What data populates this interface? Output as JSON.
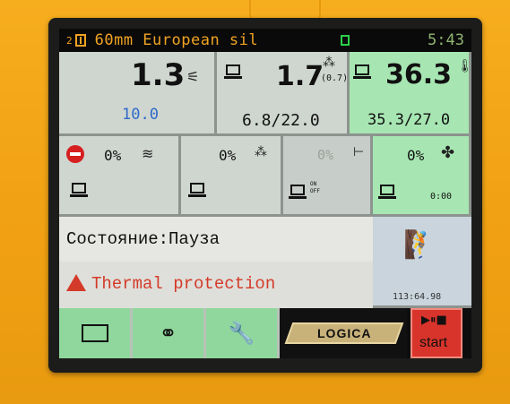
{
  "header": {
    "program_number": "2",
    "title": "60mm European sil",
    "time": "5:43"
  },
  "panels": {
    "p1": {
      "value": "1.3",
      "sub": "10.0"
    },
    "p2": {
      "value": "1.7",
      "small": "(0.7)",
      "sub": "6.8/22.0"
    },
    "p3": {
      "value": "36.3",
      "sub": "35.3/27.0"
    }
  },
  "row2": {
    "heater_pct": "0%",
    "spray_pct": "0%",
    "dim_pct": "0%",
    "fan_pct": "0%",
    "counter": "0:00",
    "on_label": "ON",
    "off_label": "OFF"
  },
  "status": {
    "state": "Состояние:Пауза",
    "alarm": "Thermal protection"
  },
  "operator": {
    "value": "113:64.98"
  },
  "footer": {
    "brand": "LOGICA",
    "start_label": "start"
  },
  "colors": {
    "accent": "#f0a322",
    "alarm": "#d43a2a",
    "panel_green": "#a7e6b2",
    "panel_gray": "#cfd6d0",
    "start_red": "#d9342b"
  }
}
